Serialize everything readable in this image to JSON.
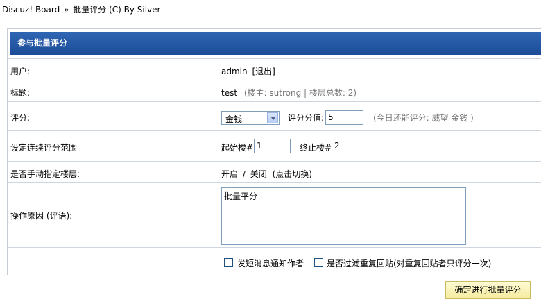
{
  "breadcrumb": {
    "home": "Discuz! Board",
    "separator": "»",
    "current": "批量评分 (C) By Silver"
  },
  "panel": {
    "title": "参与批量评分"
  },
  "rows": {
    "user": {
      "label": "用户:",
      "name": "admin",
      "logout": "[退出]"
    },
    "subject": {
      "label": "标题:",
      "title": "test",
      "meta": "(楼主: sutrong | 楼层总数: 2)"
    },
    "rate": {
      "label": "评分:",
      "select_value": "金钱",
      "score_label": "评分分值:",
      "score_value": "5",
      "remaining": "(今日还能评分: 威望 金钱 )"
    },
    "range": {
      "label": "设定连续评分范围",
      "start_label": "起始楼#",
      "start_value": "1",
      "end_label": "终止楼#",
      "end_value": "2"
    },
    "manual": {
      "label": "是否手动指定楼层:",
      "on": "开启",
      "slash": "/",
      "off": "关闭",
      "hint": "(点击切换)"
    },
    "reason": {
      "label": "操作原因 (评语):",
      "text": "批量平分"
    },
    "options": {
      "notify": {
        "label": "发短消息通知作者",
        "checked": false
      },
      "filter": {
        "label": "是否过滤重复回贴(对重复回贴者只评分一次)",
        "checked": false
      }
    }
  },
  "submit_label": "确定进行批量评分",
  "colors": {
    "header": "#1d4c98",
    "border": "#cfd5de",
    "button": "#f5ec9e"
  }
}
